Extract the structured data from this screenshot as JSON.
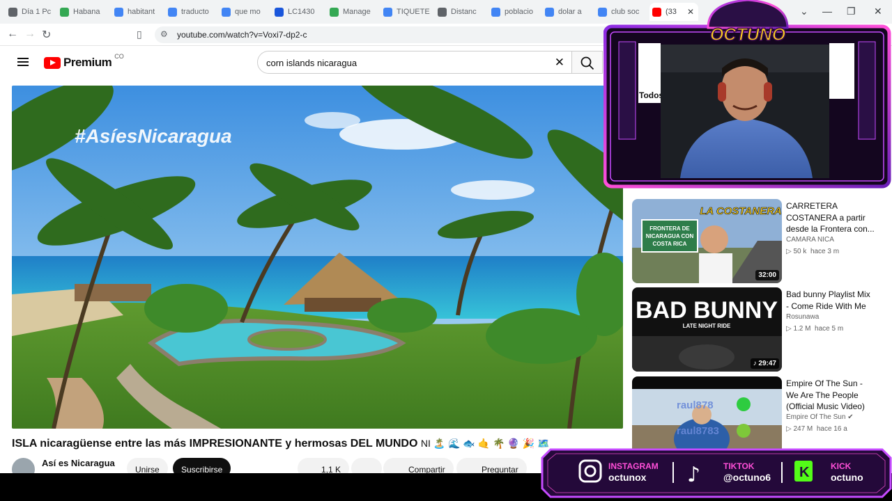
{
  "browser": {
    "tabs": [
      {
        "label": "Día 1 Pc",
        "color": "#5f6368"
      },
      {
        "label": "Habana",
        "color": "#34a853"
      },
      {
        "label": "habitant",
        "color": "#4285f4"
      },
      {
        "label": "traducto",
        "color": "#4285f4"
      },
      {
        "label": "que mo",
        "color": "#4285f4"
      },
      {
        "label": "LC1430",
        "color": "#1a56db"
      },
      {
        "label": "Manage",
        "color": "#34a853"
      },
      {
        "label": "TIQUETE",
        "color": "#4285f4"
      },
      {
        "label": "Distanc",
        "color": "#5f6368"
      },
      {
        "label": "poblacio",
        "color": "#4285f4"
      },
      {
        "label": "dolar a",
        "color": "#4285f4"
      },
      {
        "label": "club soc",
        "color": "#4285f4"
      },
      {
        "label": "(33",
        "color": "#ff0000"
      }
    ],
    "url": "youtube.com/watch?v=Voxi7-dp2-c"
  },
  "header": {
    "logo_text": "Premium",
    "country_code": "CO",
    "search_value": "corn islands nicaragua"
  },
  "player": {
    "overlay_text": "#AsíesNicaragua"
  },
  "video": {
    "title": "ISLA nicaragüense entre las más IMPRESIONANTE y hermosas DEL MUNDO",
    "title_emojis": "NI 🏝️ 🌊 🐟 🤙 🌴 🔮 🎉 🗺️",
    "channel": "Así es Nicaragua",
    "join_label": "Unirse",
    "subscribe_label": "Suscribirse",
    "likes": "1,1 K",
    "share_label": "Compartir",
    "ask_label": "Preguntar"
  },
  "recommendations": [
    {
      "title": "CARRETERA COSTANERA a partir desde la Frontera con...",
      "channel": "CAMARA NICA",
      "views": "50 k",
      "age": "hace 3 m",
      "duration": "32:00",
      "thumb_headline": "LA COSTANERA",
      "thumb_sign": "FRONTERA DE NICARAGUA CON COSTA RICA"
    },
    {
      "title": "Bad bunny Playlist Mix - Come Ride With Me",
      "channel": "Rosunawa",
      "views": "1.2 M",
      "age": "hace 5 m",
      "duration": "29:47",
      "thumb_headline": "BAD BUNNY",
      "thumb_sub": "LATE NIGHT RIDE"
    },
    {
      "title": "Empire Of The Sun - We Are The People (Official Music Video)",
      "channel": "Empire Of The Sun",
      "views": "247 M",
      "age": "hace 16 a",
      "thumb_overlay_1": "raul878",
      "thumb_overlay_2": "raul8783"
    }
  ],
  "streamer": {
    "brand": "OCTUNO",
    "cam_partial_text": "Todos",
    "instagram_label": "INSTAGRAM",
    "instagram_handle": "octunox",
    "tiktok_label": "TIKTOK",
    "tiktok_handle": "@octuno6",
    "kick_label": "KICK",
    "kick_handle": "octuno"
  },
  "colors": {
    "youtube_red": "#ff0000",
    "overlay_purple": "#8a2be2",
    "overlay_pink": "#ff4fd8",
    "kick_green": "#53fc18"
  }
}
